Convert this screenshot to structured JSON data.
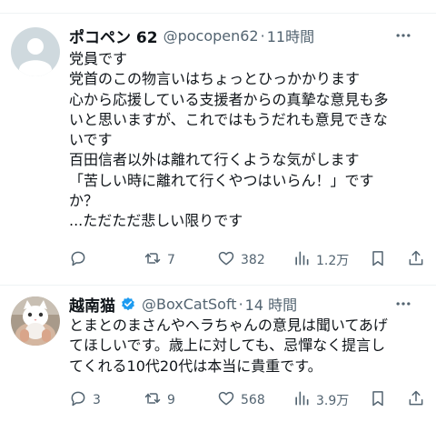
{
  "tweets": [
    {
      "name": "ポコペン 62",
      "handle": "@pocopen62",
      "separator": "·",
      "time": "11時間",
      "lines": [
        "党員です",
        "党首のこの物言いはちょっとひっかかります",
        "心から応援している支援者からの真摯な意見も多",
        "いと思いますが、これではもうだれも意見できな",
        "いです",
        "百田信者以外は離れて行くような気がします",
        "「苦しい時に離れて行くやつはいらん！」です",
        "か？",
        "...ただただ悲しい限りです"
      ],
      "reply_count": "",
      "retweet_count": "7",
      "like_count": "382",
      "view_count": "1.2万",
      "verified": false,
      "avatar": "default-avatar"
    },
    {
      "name": "越南猫",
      "handle": "@BoxCatSoft",
      "separator": "·",
      "time": "14 時間",
      "lines": [
        "とまとのまさんやヘラちゃんの意見は聞いてあげ",
        "てほしいです。歳上に対しても、忌憚なく提言し",
        "てくれる10代20代は本当に貴重です。"
      ],
      "reply_count": "3",
      "retweet_count": "9",
      "like_count": "568",
      "view_count": "3.9万",
      "verified": true,
      "avatar": "cat-photo-avatar"
    }
  ],
  "colors": {
    "text": "#0f1419",
    "secondary": "#536471",
    "verified": "#1d9bf0",
    "divider": "#eff3f4"
  }
}
